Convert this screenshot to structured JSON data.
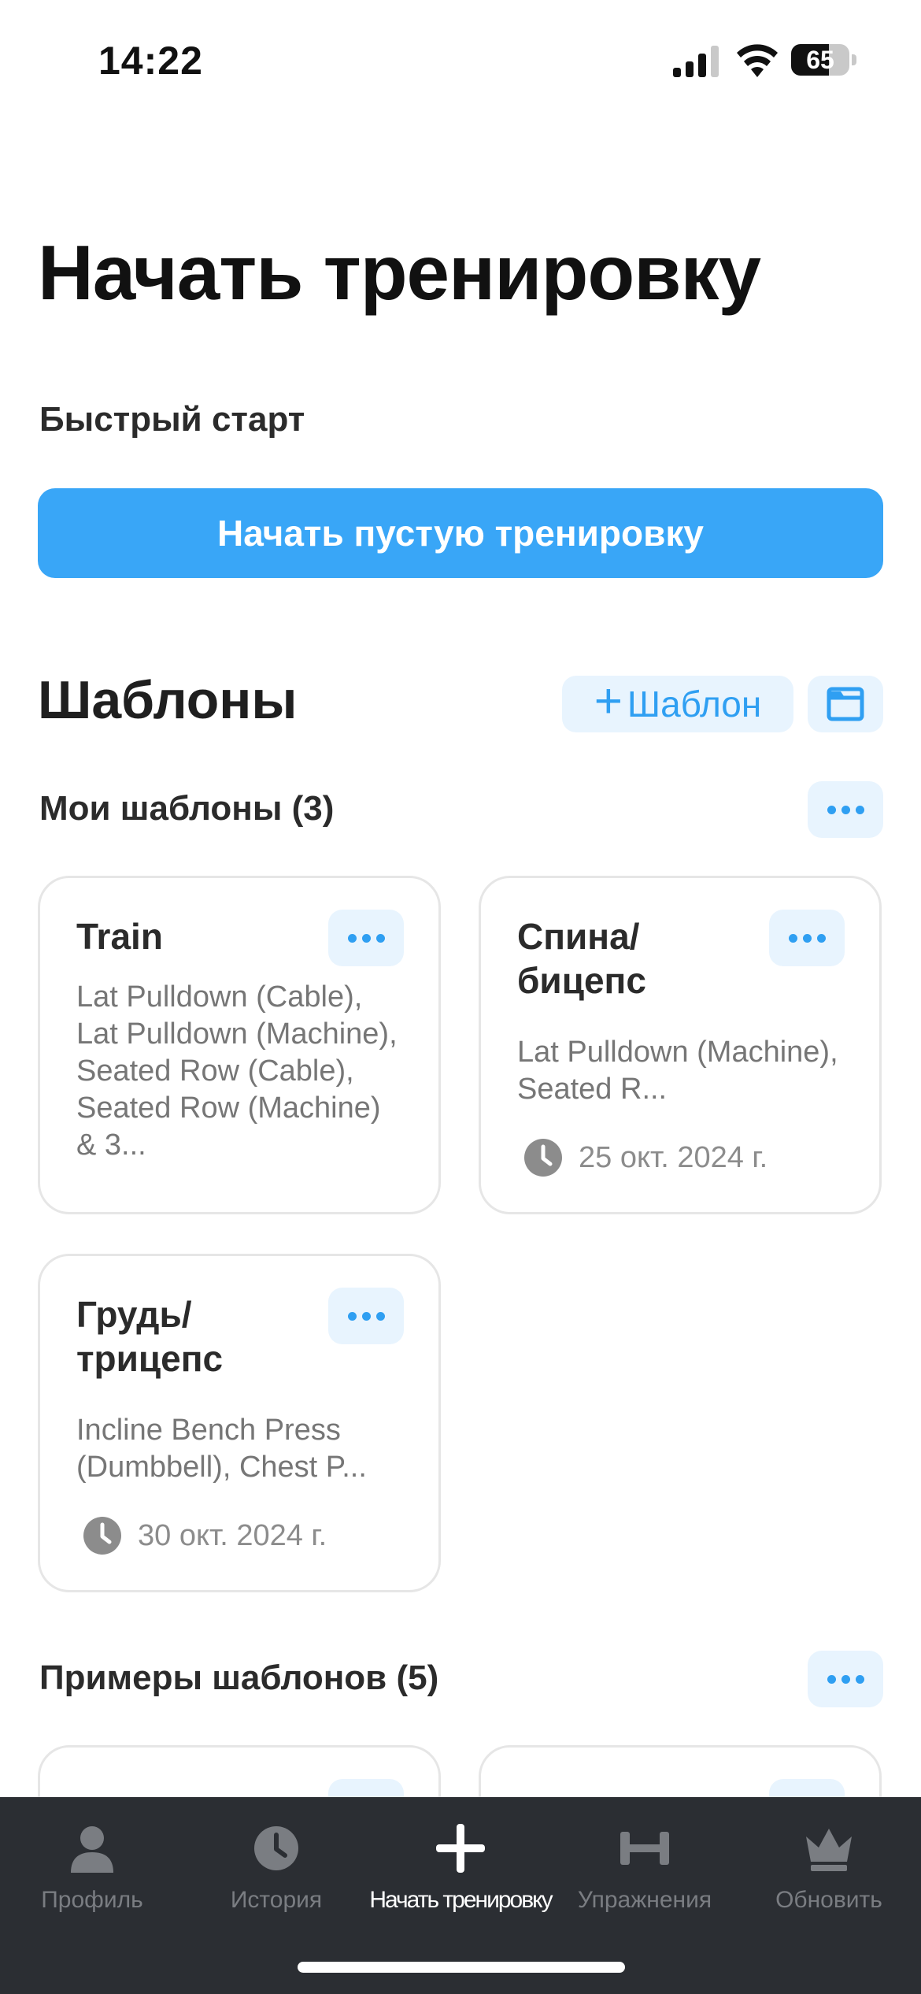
{
  "status_bar": {
    "time": "14:22",
    "battery_level": "65",
    "icons": [
      "signal-icon",
      "wifi-icon",
      "battery-icon"
    ]
  },
  "page_title": "Начать тренировку",
  "quick_start": {
    "label": "Быстрый старт",
    "button_label": "Начать пустую тренировку"
  },
  "templates": {
    "title": "Шаблоны",
    "add_button_label": "Шаблон",
    "my_templates": {
      "title": "Мои шаблоны (3)",
      "cards": [
        {
          "title": "Train",
          "description": "Lat Pulldown (Cable), Lat Pulldown (Machine), Seated Row (Cable), Seated Row (Machine) & 3...",
          "date": ""
        },
        {
          "title": "Спина/ бицепс",
          "description": "Lat Pulldown (Machine), Seated R...",
          "date": "25 окт. 2024 г."
        },
        {
          "title": "Грудь/ трицепс",
          "description": "Incline Bench Press (Dumbbell), Chest P...",
          "date": "30 окт. 2024 г."
        }
      ]
    },
    "example_templates": {
      "title": "Примеры шаблонов (5)"
    }
  },
  "tab_bar": {
    "items": [
      {
        "label": "Профиль",
        "icon": "profile-icon"
      },
      {
        "label": "История",
        "icon": "history-icon"
      },
      {
        "label": "Начать тренировку",
        "icon": "plus-icon"
      },
      {
        "label": "Упражнения",
        "icon": "dumbbell-icon"
      },
      {
        "label": "Обновить",
        "icon": "crown-icon"
      }
    ],
    "active_index": 2
  },
  "colors": {
    "accent": "#39a6f7",
    "accent_light": "#e8f4fe",
    "tab_bar_bg": "#2b2e33"
  }
}
